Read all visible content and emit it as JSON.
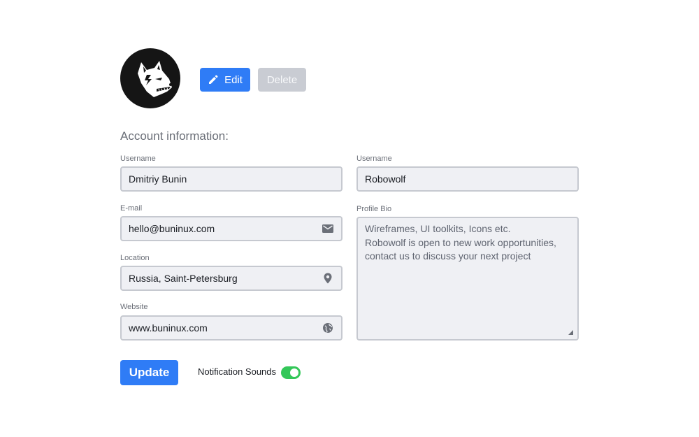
{
  "profile": {
    "edit_label": "Edit",
    "delete_label": "Delete"
  },
  "account": {
    "title": "Account information:",
    "fields": {
      "username_left": {
        "label": "Username",
        "value": "Dmitriy Bunin"
      },
      "email": {
        "label": "E-mail",
        "value": "hello@buninux.com",
        "icon": "mail-icon"
      },
      "location": {
        "label": "Location",
        "value": "Russia, Saint-Petersburg",
        "icon": "location-pin-icon"
      },
      "website": {
        "label": "Website",
        "value": "www.buninux.com",
        "icon": "globe-icon"
      },
      "username_right": {
        "label": "Username",
        "value": "Robowolf"
      },
      "bio": {
        "label": "Profile Bio",
        "lines": [
          "Wireframes, UI toolkits, Icons etc.",
          "Robowolf is open to new work opportunities,",
          "contact us to discuss your next project"
        ]
      }
    }
  },
  "footer": {
    "update_label": "Update",
    "notification_label": "Notification Sounds",
    "notification_on": true
  },
  "colors": {
    "primary": "#2f7cf6",
    "disabled": "#c9ccd3",
    "toggle_on": "#34c759",
    "field_bg": "#eff0f4",
    "field_border": "#c6c9d0"
  }
}
